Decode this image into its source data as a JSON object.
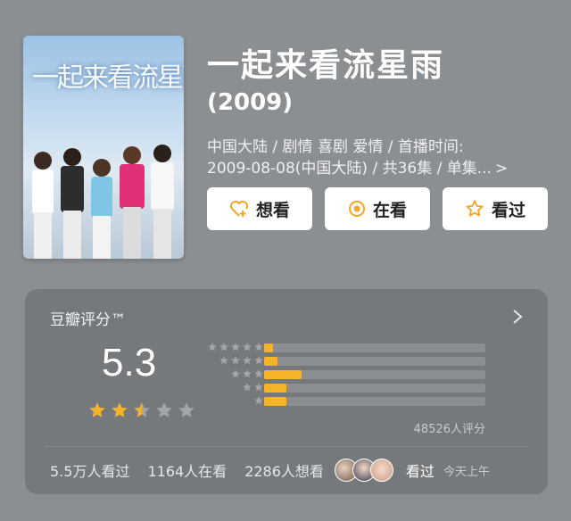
{
  "poster": {
    "title_art": "一起来看流星雨"
  },
  "movie": {
    "title": "一起来看流星雨",
    "year": "(2009)",
    "meta_line1": "中国大陆 / 剧情 喜剧 爱情 / 首播时间:",
    "meta_line2": "2009-08-08(中国大陆) / 共36集 / 单集...",
    "meta_more": ">"
  },
  "actions": {
    "want": "想看",
    "watching": "在看",
    "watched": "看过"
  },
  "rating": {
    "header": "豆瓣评分™",
    "score": "5.3",
    "score_stars": 2.5,
    "distribution": [
      {
        "stars": 5,
        "fraction": 0.04
      },
      {
        "stars": 4,
        "fraction": 0.06
      },
      {
        "stars": 3,
        "fraction": 0.17
      },
      {
        "stars": 2,
        "fraction": 0.1
      },
      {
        "stars": 1,
        "fraction": 0.1
      }
    ],
    "count_text": "48526人评分",
    "footer": {
      "watched": "5.5万人看过",
      "watching": "1164人在看",
      "want": "2286人想看",
      "friends_label": "看过",
      "time": "今天上午"
    }
  },
  "colors": {
    "background": "#8c8f92",
    "card": "#76797c",
    "accent": "#f5b32a"
  }
}
